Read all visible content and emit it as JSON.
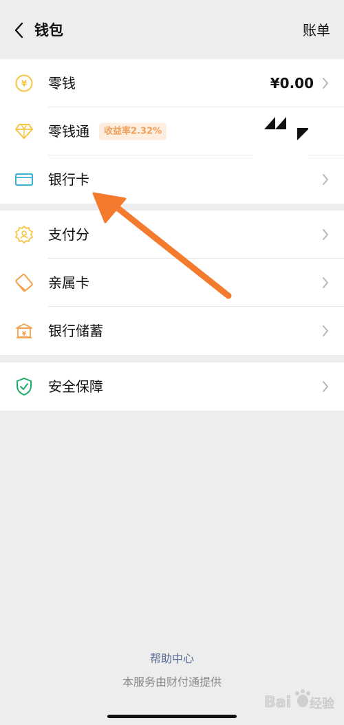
{
  "header": {
    "title": "钱包",
    "bill_label": "账单"
  },
  "group1": [
    {
      "label": "零钱",
      "value": "¥0.00",
      "icon": "coin-yen-icon"
    },
    {
      "label": "零钱通",
      "badge": "收益率2.32%",
      "icon": "diamond-icon"
    },
    {
      "label": "银行卡",
      "icon": "bank-card-icon"
    }
  ],
  "group2": [
    {
      "label": "支付分",
      "icon": "pay-score-badge-icon"
    },
    {
      "label": "亲属卡",
      "icon": "family-card-icon"
    },
    {
      "label": "银行储蓄",
      "icon": "bank-savings-icon"
    }
  ],
  "group3": [
    {
      "label": "安全保障",
      "icon": "shield-check-icon"
    }
  ],
  "footer": {
    "help": "帮助中心",
    "provider": "本服务由财付通提供"
  },
  "watermark": {
    "text": "Bai经验"
  },
  "colors": {
    "yellow": "#f6c543",
    "cyan": "#3bb3d6",
    "orange": "#f2a04c",
    "green": "#1aad66",
    "arrow": "#f47a2e",
    "link": "#576b95"
  }
}
